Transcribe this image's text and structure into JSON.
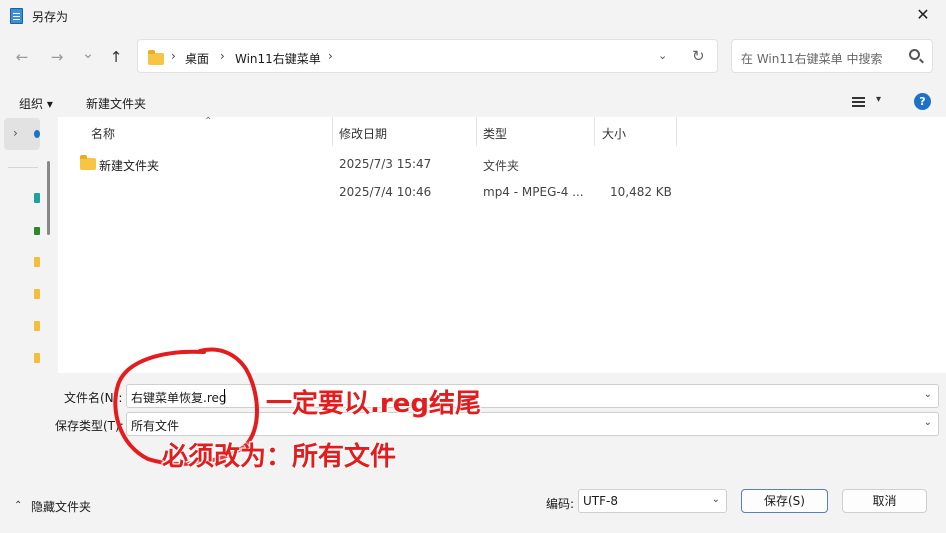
{
  "window": {
    "title": "另存为",
    "close_glyph": "✕"
  },
  "nav": {
    "back_glyph": "←",
    "forward_glyph": "→",
    "recent_glyph": "⌄",
    "up_glyph": "↑",
    "breadcrumb": [
      "桌面",
      "Win11右键菜单"
    ],
    "breadcrumb_sep": "›",
    "dropdown_glyph": "⌄",
    "refresh_glyph": "↻",
    "search_placeholder": "在 Win11右键菜单 中搜索"
  },
  "toolbar": {
    "organize_label": "组织 ▾",
    "new_folder_label": "新建文件夹",
    "view_dd_glyph": "▾",
    "help_glyph": "?"
  },
  "nav_pane": {
    "expand_glyph": "›"
  },
  "columns": {
    "name": "名称",
    "date": "修改日期",
    "type": "类型",
    "size": "大小",
    "sort_glyph": "⌃"
  },
  "files": [
    {
      "name": "新建文件夹",
      "date": "2025/7/3 15:47",
      "type": "文件夹",
      "size": ""
    },
    {
      "name": "",
      "date": "2025/7/4 10:46",
      "type": "mp4 - MPEG-4 ...",
      "size": "10,482 KB"
    }
  ],
  "form": {
    "filename_label": "文件名(N):",
    "filename_value": "右键菜单恢复.reg",
    "filetype_label": "保存类型(T):",
    "filetype_value": "所有文件",
    "encoding_label": "编码:",
    "encoding_value": "UTF-8",
    "dd_glyph": "⌄"
  },
  "buttons": {
    "save": "保存(S)",
    "cancel": "取消"
  },
  "hide_folders": {
    "icon_glyph": "⌃",
    "label": "隐藏文件夹"
  },
  "annotations": {
    "reg_ending": "一定要以.reg结尾",
    "all_files": "必须改为：所有文件",
    "color": "#e31d1d"
  }
}
